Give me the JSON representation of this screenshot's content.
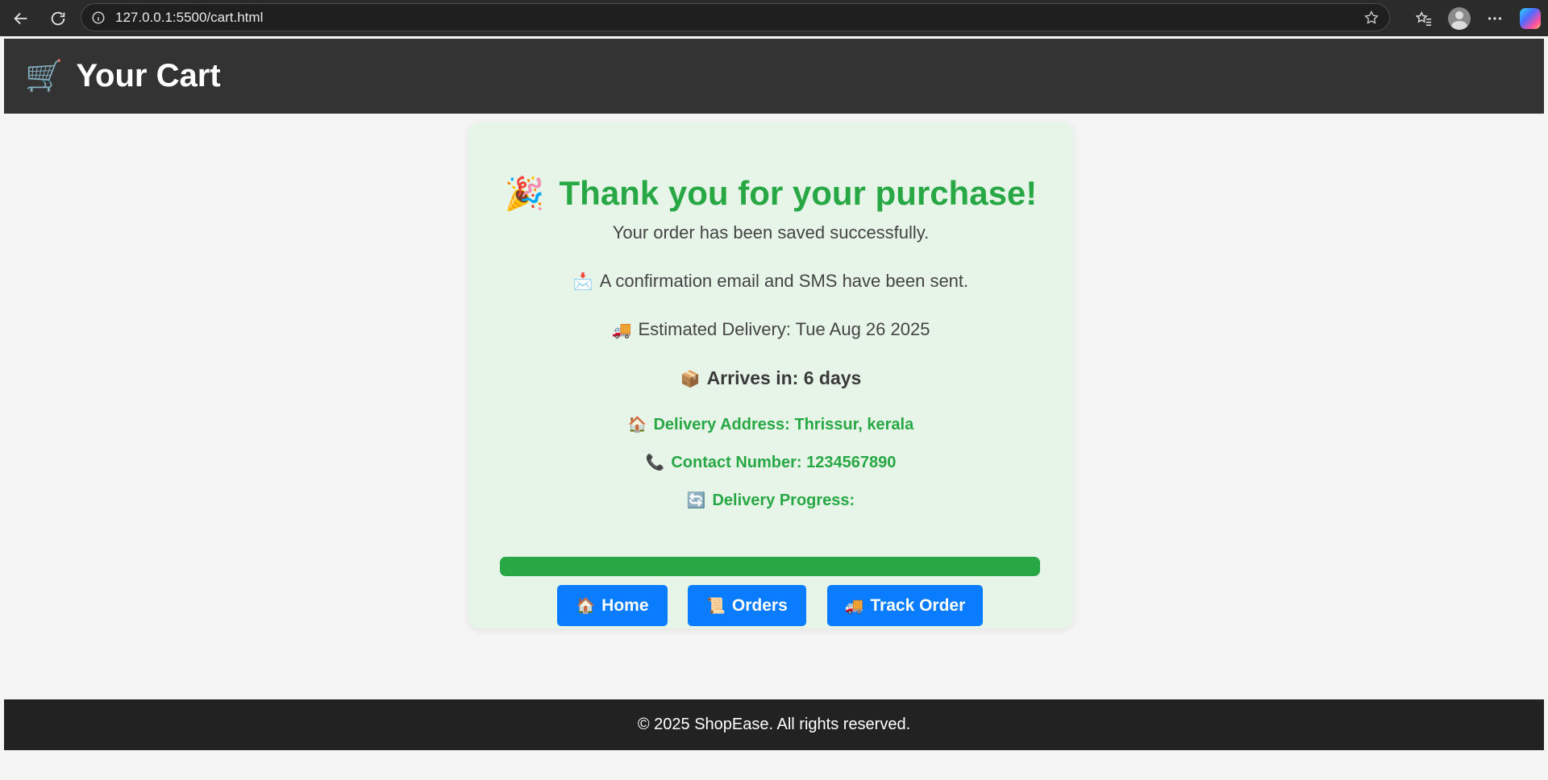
{
  "browser": {
    "url": "127.0.0.1:5500/cart.html"
  },
  "header": {
    "cart_icon": "🛒",
    "title": "Your Cart"
  },
  "confirmation": {
    "title_emoji": "🎉",
    "title": "Thank you for your purchase!",
    "saved_text": "Your order has been saved successfully.",
    "email_emoji": "📩",
    "email_text": "A confirmation email and SMS have been sent.",
    "estimate_emoji": "🚚",
    "estimate_text": "Estimated Delivery: Tue Aug 26 2025",
    "arrives_emoji": "📦",
    "arrives_text": "Arrives in: 6 days",
    "address_emoji": "🏠",
    "address_text": "Delivery Address: Thrissur, kerala",
    "contact_emoji": "📞",
    "contact_text": "Contact Number: 1234567890",
    "progress_emoji": "🔄",
    "progress_label": "Delivery Progress:",
    "progress_value": 1.0
  },
  "buttons": {
    "home_emoji": "🏠",
    "home": "Home",
    "orders_emoji": "📜",
    "orders": "Orders",
    "track_emoji": "🚚",
    "track": "Track Order"
  },
  "footer": {
    "text": "© 2025 ShopEase. All rights reserved."
  },
  "colors": {
    "accent_green": "#28a745",
    "button_blue": "#0a7cff",
    "header_bg": "#333333",
    "card_bg": "#e7f5e8"
  }
}
